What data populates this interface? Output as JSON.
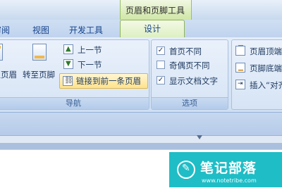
{
  "window": {
    "contextual_title": "页眉和页脚工具"
  },
  "tabs": [
    {
      "label": "审阅",
      "partial": "审阅"
    },
    {
      "label": "视图"
    },
    {
      "label": "开发工具"
    },
    {
      "label": "设计",
      "active": true
    }
  ],
  "ribbon": {
    "navigation": {
      "label": "导航",
      "goto_header_partial": "转至页眉",
      "goto_footer": "转至页脚",
      "previous_section": "上一节",
      "next_section": "下一节",
      "link_to_previous": "链接到前一条页眉"
    },
    "options": {
      "label": "选项",
      "different_first_page": {
        "label": "首页不同",
        "checked": true
      },
      "different_odd_even": {
        "label": "奇偶页不同",
        "checked": false
      },
      "show_document_text": {
        "label": "显示文档文字",
        "checked": true
      }
    },
    "position": {
      "header_from_top": "页眉顶端距离",
      "footer_from_bottom": "页脚底端距离",
      "insert_alignment_tab": "插入“对齐方式”选项卡"
    }
  },
  "watermark": {
    "title": "笔记部落",
    "url": "www.notetribe.com"
  },
  "colors": {
    "contextual_accent": "#cfe6a6",
    "watermark_bg": "#00b4be",
    "highlight": "#ffe38a"
  }
}
